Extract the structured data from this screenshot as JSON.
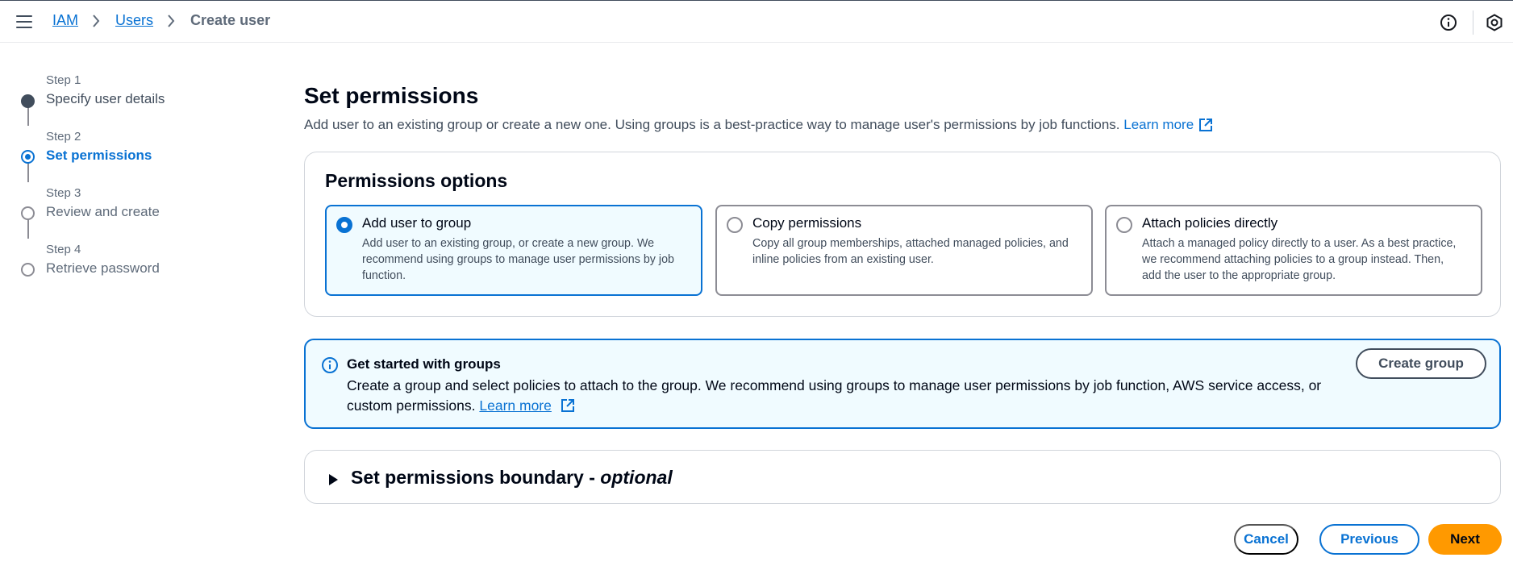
{
  "breadcrumb": {
    "items": [
      "IAM",
      "Users"
    ],
    "current": "Create user"
  },
  "steps": [
    {
      "number": "Step 1",
      "title": "Specify user details",
      "state": "completed"
    },
    {
      "number": "Step 2",
      "title": "Set permissions",
      "state": "active"
    },
    {
      "number": "Step 3",
      "title": "Review and create",
      "state": "pending"
    },
    {
      "number": "Step 4",
      "title": "Retrieve password",
      "state": "pending"
    }
  ],
  "page": {
    "title": "Set permissions",
    "description": "Add user to an existing group or create a new one. Using groups is a best-practice way to manage user's permissions by job functions.",
    "learn_more": "Learn more"
  },
  "permissions": {
    "title": "Permissions options",
    "selected": "Add user to group",
    "options": [
      {
        "title": "Add user to group",
        "desc": "Add user to an existing group, or create a new group. We recommend using groups to manage user permissions by job function."
      },
      {
        "title": "Copy permissions",
        "desc": "Copy all group memberships, attached managed policies, and inline policies from an existing user."
      },
      {
        "title": "Attach policies directly",
        "desc": "Attach a managed policy directly to a user. As a best practice, we recommend attaching policies to a group instead. Then, add the user to the appropriate group."
      }
    ]
  },
  "alert": {
    "title": "Get started with groups",
    "text": "Create a group and select policies to attach to the group. We recommend using groups to manage user permissions by job function, AWS service access, or custom permissions.",
    "learn_more": "Learn more",
    "button": "Create group"
  },
  "boundary": {
    "title": "Set permissions boundary - ",
    "optional": "optional"
  },
  "actions": {
    "cancel": "Cancel",
    "previous": "Previous",
    "next": "Next"
  },
  "colors": {
    "primary": "#0972d3",
    "next_button": "#ff9900",
    "alert_bg": "#f0fbff",
    "text": "#000716"
  }
}
